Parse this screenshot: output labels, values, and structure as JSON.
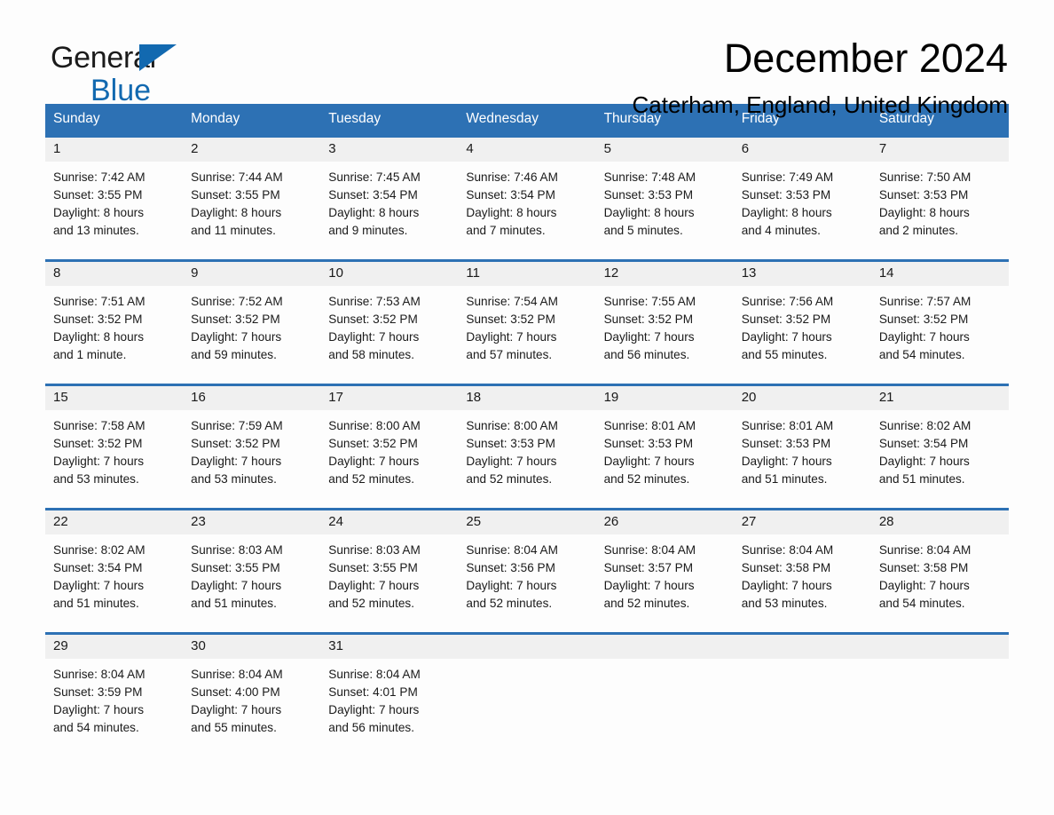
{
  "brand": {
    "name_line1": "General",
    "name_line2": "Blue",
    "flag_icon": "triangle-flag-icon",
    "accent_color": "#1269b0"
  },
  "header": {
    "title": "December 2024",
    "location": "Caterham, England, United Kingdom"
  },
  "theme": {
    "header_blue": "#2d71b4",
    "day_band_gray": "#f0f0f0",
    "page_background": "#fdfdfd"
  },
  "calendar": {
    "weekday_headers": [
      "Sunday",
      "Monday",
      "Tuesday",
      "Wednesday",
      "Thursday",
      "Friday",
      "Saturday"
    ],
    "weeks": [
      [
        {
          "day": "1",
          "sunrise": "Sunrise: 7:42 AM",
          "sunset": "Sunset: 3:55 PM",
          "daylight1": "Daylight: 8 hours",
          "daylight2": "and 13 minutes."
        },
        {
          "day": "2",
          "sunrise": "Sunrise: 7:44 AM",
          "sunset": "Sunset: 3:55 PM",
          "daylight1": "Daylight: 8 hours",
          "daylight2": "and 11 minutes."
        },
        {
          "day": "3",
          "sunrise": "Sunrise: 7:45 AM",
          "sunset": "Sunset: 3:54 PM",
          "daylight1": "Daylight: 8 hours",
          "daylight2": "and 9 minutes."
        },
        {
          "day": "4",
          "sunrise": "Sunrise: 7:46 AM",
          "sunset": "Sunset: 3:54 PM",
          "daylight1": "Daylight: 8 hours",
          "daylight2": "and 7 minutes."
        },
        {
          "day": "5",
          "sunrise": "Sunrise: 7:48 AM",
          "sunset": "Sunset: 3:53 PM",
          "daylight1": "Daylight: 8 hours",
          "daylight2": "and 5 minutes."
        },
        {
          "day": "6",
          "sunrise": "Sunrise: 7:49 AM",
          "sunset": "Sunset: 3:53 PM",
          "daylight1": "Daylight: 8 hours",
          "daylight2": "and 4 minutes."
        },
        {
          "day": "7",
          "sunrise": "Sunrise: 7:50 AM",
          "sunset": "Sunset: 3:53 PM",
          "daylight1": "Daylight: 8 hours",
          "daylight2": "and 2 minutes."
        }
      ],
      [
        {
          "day": "8",
          "sunrise": "Sunrise: 7:51 AM",
          "sunset": "Sunset: 3:52 PM",
          "daylight1": "Daylight: 8 hours",
          "daylight2": "and 1 minute."
        },
        {
          "day": "9",
          "sunrise": "Sunrise: 7:52 AM",
          "sunset": "Sunset: 3:52 PM",
          "daylight1": "Daylight: 7 hours",
          "daylight2": "and 59 minutes."
        },
        {
          "day": "10",
          "sunrise": "Sunrise: 7:53 AM",
          "sunset": "Sunset: 3:52 PM",
          "daylight1": "Daylight: 7 hours",
          "daylight2": "and 58 minutes."
        },
        {
          "day": "11",
          "sunrise": "Sunrise: 7:54 AM",
          "sunset": "Sunset: 3:52 PM",
          "daylight1": "Daylight: 7 hours",
          "daylight2": "and 57 minutes."
        },
        {
          "day": "12",
          "sunrise": "Sunrise: 7:55 AM",
          "sunset": "Sunset: 3:52 PM",
          "daylight1": "Daylight: 7 hours",
          "daylight2": "and 56 minutes."
        },
        {
          "day": "13",
          "sunrise": "Sunrise: 7:56 AM",
          "sunset": "Sunset: 3:52 PM",
          "daylight1": "Daylight: 7 hours",
          "daylight2": "and 55 minutes."
        },
        {
          "day": "14",
          "sunrise": "Sunrise: 7:57 AM",
          "sunset": "Sunset: 3:52 PM",
          "daylight1": "Daylight: 7 hours",
          "daylight2": "and 54 minutes."
        }
      ],
      [
        {
          "day": "15",
          "sunrise": "Sunrise: 7:58 AM",
          "sunset": "Sunset: 3:52 PM",
          "daylight1": "Daylight: 7 hours",
          "daylight2": "and 53 minutes."
        },
        {
          "day": "16",
          "sunrise": "Sunrise: 7:59 AM",
          "sunset": "Sunset: 3:52 PM",
          "daylight1": "Daylight: 7 hours",
          "daylight2": "and 53 minutes."
        },
        {
          "day": "17",
          "sunrise": "Sunrise: 8:00 AM",
          "sunset": "Sunset: 3:52 PM",
          "daylight1": "Daylight: 7 hours",
          "daylight2": "and 52 minutes."
        },
        {
          "day": "18",
          "sunrise": "Sunrise: 8:00 AM",
          "sunset": "Sunset: 3:53 PM",
          "daylight1": "Daylight: 7 hours",
          "daylight2": "and 52 minutes."
        },
        {
          "day": "19",
          "sunrise": "Sunrise: 8:01 AM",
          "sunset": "Sunset: 3:53 PM",
          "daylight1": "Daylight: 7 hours",
          "daylight2": "and 52 minutes."
        },
        {
          "day": "20",
          "sunrise": "Sunrise: 8:01 AM",
          "sunset": "Sunset: 3:53 PM",
          "daylight1": "Daylight: 7 hours",
          "daylight2": "and 51 minutes."
        },
        {
          "day": "21",
          "sunrise": "Sunrise: 8:02 AM",
          "sunset": "Sunset: 3:54 PM",
          "daylight1": "Daylight: 7 hours",
          "daylight2": "and 51 minutes."
        }
      ],
      [
        {
          "day": "22",
          "sunrise": "Sunrise: 8:02 AM",
          "sunset": "Sunset: 3:54 PM",
          "daylight1": "Daylight: 7 hours",
          "daylight2": "and 51 minutes."
        },
        {
          "day": "23",
          "sunrise": "Sunrise: 8:03 AM",
          "sunset": "Sunset: 3:55 PM",
          "daylight1": "Daylight: 7 hours",
          "daylight2": "and 51 minutes."
        },
        {
          "day": "24",
          "sunrise": "Sunrise: 8:03 AM",
          "sunset": "Sunset: 3:55 PM",
          "daylight1": "Daylight: 7 hours",
          "daylight2": "and 52 minutes."
        },
        {
          "day": "25",
          "sunrise": "Sunrise: 8:04 AM",
          "sunset": "Sunset: 3:56 PM",
          "daylight1": "Daylight: 7 hours",
          "daylight2": "and 52 minutes."
        },
        {
          "day": "26",
          "sunrise": "Sunrise: 8:04 AM",
          "sunset": "Sunset: 3:57 PM",
          "daylight1": "Daylight: 7 hours",
          "daylight2": "and 52 minutes."
        },
        {
          "day": "27",
          "sunrise": "Sunrise: 8:04 AM",
          "sunset": "Sunset: 3:58 PM",
          "daylight1": "Daylight: 7 hours",
          "daylight2": "and 53 minutes."
        },
        {
          "day": "28",
          "sunrise": "Sunrise: 8:04 AM",
          "sunset": "Sunset: 3:58 PM",
          "daylight1": "Daylight: 7 hours",
          "daylight2": "and 54 minutes."
        }
      ],
      [
        {
          "day": "29",
          "sunrise": "Sunrise: 8:04 AM",
          "sunset": "Sunset: 3:59 PM",
          "daylight1": "Daylight: 7 hours",
          "daylight2": "and 54 minutes."
        },
        {
          "day": "30",
          "sunrise": "Sunrise: 8:04 AM",
          "sunset": "Sunset: 4:00 PM",
          "daylight1": "Daylight: 7 hours",
          "daylight2": "and 55 minutes."
        },
        {
          "day": "31",
          "sunrise": "Sunrise: 8:04 AM",
          "sunset": "Sunset: 4:01 PM",
          "daylight1": "Daylight: 7 hours",
          "daylight2": "and 56 minutes."
        },
        {
          "day": "",
          "sunrise": "",
          "sunset": "",
          "daylight1": "",
          "daylight2": ""
        },
        {
          "day": "",
          "sunrise": "",
          "sunset": "",
          "daylight1": "",
          "daylight2": ""
        },
        {
          "day": "",
          "sunrise": "",
          "sunset": "",
          "daylight1": "",
          "daylight2": ""
        },
        {
          "day": "",
          "sunrise": "",
          "sunset": "",
          "daylight1": "",
          "daylight2": ""
        }
      ]
    ]
  }
}
